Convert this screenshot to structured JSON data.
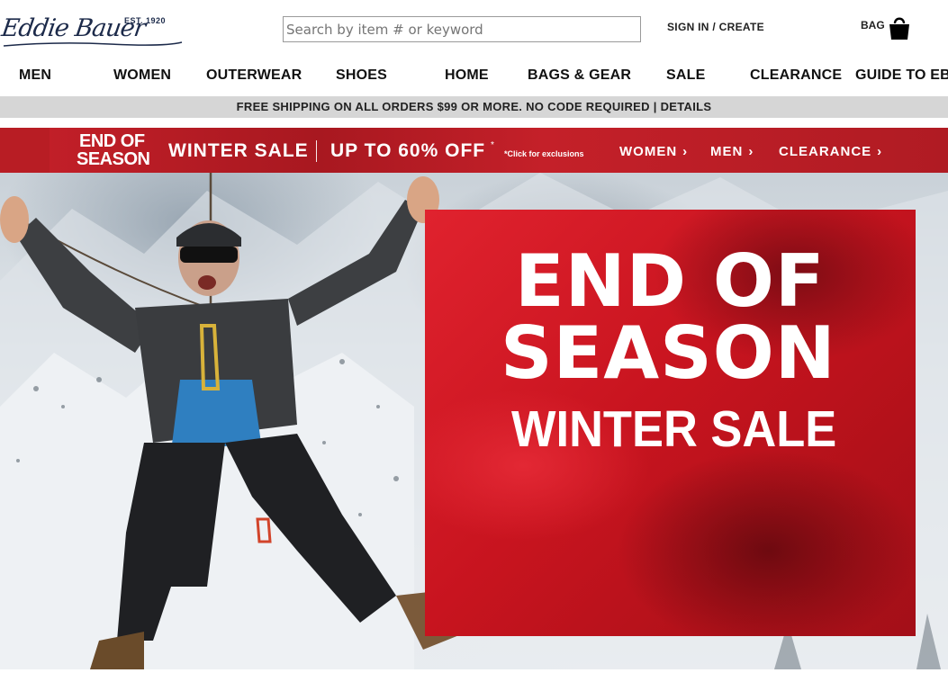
{
  "header": {
    "logo_text": "Eddie Bauer",
    "logo_est": "EST. 1920",
    "search_placeholder": "Search by item # or keyword",
    "sign_in": "SIGN IN / CREATE",
    "bag_label": "BAG",
    "icons": [
      "logo",
      "shopping-bag-icon"
    ]
  },
  "nav": {
    "items": [
      {
        "label": "MEN"
      },
      {
        "label": "WOMEN"
      },
      {
        "label": "OUTERWEAR"
      },
      {
        "label": "SHOES"
      },
      {
        "label": "HOME"
      },
      {
        "label": "BAGS & GEAR"
      },
      {
        "label": "SALE"
      },
      {
        "label": "CLEARANCE"
      },
      {
        "label": "GUIDE TO EB"
      }
    ]
  },
  "shipping_bar": {
    "text": "FREE SHIPPING ON ALL ORDERS $99 OR MORE. NO CODE REQUIRED | DETAILS"
  },
  "promo": {
    "eos_line1": "END OF",
    "eos_line2": "SEASON",
    "winter_sale": "WINTER SALE",
    "discount": "UP TO 60% OFF",
    "asterisk": "*",
    "exclusions": "*Click for exclusions",
    "links": [
      {
        "label": "WOMEN"
      },
      {
        "label": "MEN"
      },
      {
        "label": "CLEARANCE"
      }
    ],
    "color": "#b81d24"
  },
  "hero": {
    "line1": "END OF",
    "line2": "SEASON",
    "line3": "WINTER SALE",
    "box_color": "#c8141f"
  }
}
